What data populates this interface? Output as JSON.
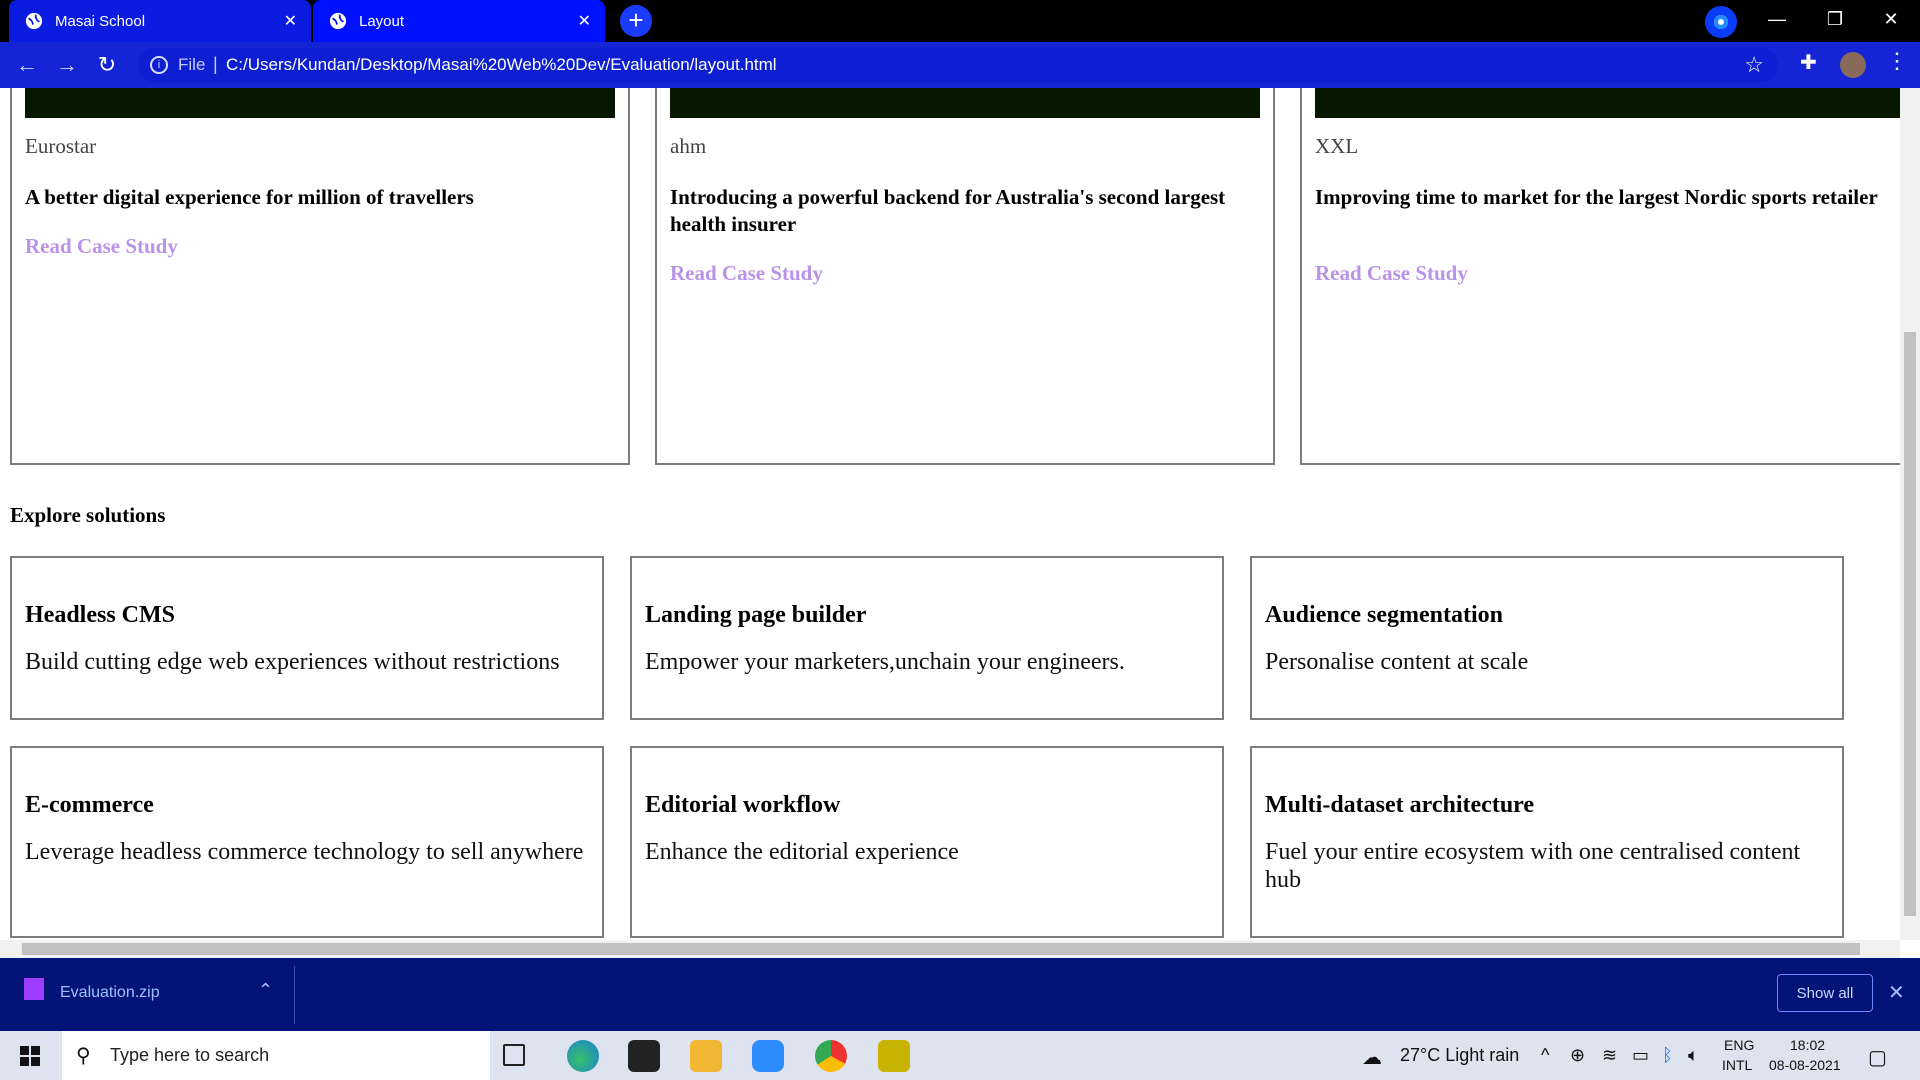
{
  "browser": {
    "tabs": [
      {
        "title": "Masai School"
      },
      {
        "title": "Layout"
      }
    ],
    "address": {
      "scheme_label": "File",
      "url": "C:/Users/Kundan/Desktop/Masai%20Web%20Dev/Evaluation/layout.html"
    }
  },
  "page": {
    "case_studies": [
      {
        "brand": "Eurostar",
        "headline": "A better digital experience for million of travellers",
        "link": "Read Case Study"
      },
      {
        "brand": "ahm",
        "headline": "Introducing a powerful backend for Australia's second largest health insurer",
        "link": "Read Case Study"
      },
      {
        "brand": "XXL",
        "headline": "Improving time to market for the largest Nordic sports retailer",
        "link": "Read Case Study"
      }
    ],
    "explore_heading": "Explore solutions",
    "solutions": [
      {
        "title": "Headless CMS",
        "desc": "Build cutting edge web experiences without restrictions"
      },
      {
        "title": "Landing page builder",
        "desc": "Empower your marketers,unchain your engineers."
      },
      {
        "title": "Audience segmentation",
        "desc": "Personalise content at scale"
      },
      {
        "title": "E-commerce",
        "desc": "Leverage headless commerce technology to sell anywhere"
      },
      {
        "title": "Editorial workflow",
        "desc": "Enhance the editorial experience"
      },
      {
        "title": "Multi-dataset architecture",
        "desc": "Fuel your entire ecosystem with one centralised content hub"
      }
    ],
    "link_color": "#b993e8"
  },
  "downloads": {
    "file": "Evaluation.zip",
    "show_all": "Show all"
  },
  "taskbar": {
    "search_placeholder": "Type here to search",
    "weather": "27°C  Light rain",
    "lang_top": "ENG",
    "lang_bottom": "INTL",
    "time": "18:02",
    "date": "08-08-2021"
  }
}
